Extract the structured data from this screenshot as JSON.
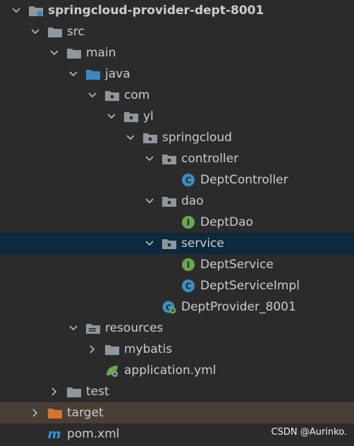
{
  "project_tree": {
    "items": [
      {
        "label": "springcloud-provider-dept-8001",
        "type": "module",
        "expanded": true
      },
      {
        "label": "src",
        "type": "folder",
        "expanded": true
      },
      {
        "label": "main",
        "type": "folder",
        "expanded": true
      },
      {
        "label": "java",
        "type": "source-root",
        "expanded": true
      },
      {
        "label": "com",
        "type": "package",
        "expanded": true
      },
      {
        "label": "yl",
        "type": "package",
        "expanded": true
      },
      {
        "label": "springcloud",
        "type": "package",
        "expanded": true
      },
      {
        "label": "controller",
        "type": "package",
        "expanded": true
      },
      {
        "label": "DeptController",
        "type": "class"
      },
      {
        "label": "dao",
        "type": "package",
        "expanded": true
      },
      {
        "label": "DeptDao",
        "type": "interface"
      },
      {
        "label": "service",
        "type": "package",
        "expanded": true,
        "selected": true
      },
      {
        "label": "DeptService",
        "type": "interface"
      },
      {
        "label": "DeptServiceImpl",
        "type": "class"
      },
      {
        "label": "DeptProvider_8001",
        "type": "spring-boot-class"
      },
      {
        "label": "resources",
        "type": "resources-root",
        "expanded": true
      },
      {
        "label": "mybatis",
        "type": "folder",
        "expanded": false
      },
      {
        "label": "application.yml",
        "type": "yaml"
      },
      {
        "label": "test",
        "type": "folder",
        "expanded": false
      },
      {
        "label": "target",
        "type": "excluded-folder",
        "expanded": false
      },
      {
        "label": "pom.xml",
        "type": "maven-file"
      }
    ]
  },
  "watermark": "CSDN @Aurinko.",
  "colors": {
    "background": "#2b2b2b",
    "selected_row": "#0d293e",
    "target_row": "#4a3f35",
    "text": "#c9ccd1",
    "folder_gray": "#8f969c",
    "source_blue": "#3d86bf",
    "target_orange": "#d47633",
    "class_blue": "#3f8fbf",
    "interface_green": "#6aa84f",
    "maven_blue": "#3f8fd2"
  }
}
